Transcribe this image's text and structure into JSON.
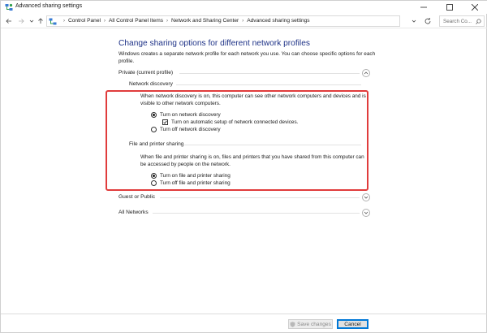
{
  "window": {
    "title": "Advanced sharing settings"
  },
  "breadcrumb": {
    "items": [
      "Control Panel",
      "All Control Panel Items",
      "Network and Sharing Center",
      "Advanced sharing settings"
    ],
    "separator": "›"
  },
  "search": {
    "placeholder": "Search Co..."
  },
  "page": {
    "heading": "Change sharing options for different network profiles",
    "intro": "Windows creates a separate network profile for each network you use. You can choose specific options for each profile."
  },
  "profiles": {
    "private": {
      "label": "Private (current profile)",
      "expanded": true,
      "network_discovery": {
        "label": "Network discovery",
        "description": "When network discovery is on, this computer can see other network computers and devices and is visible to other network computers.",
        "turn_on": "Turn on network discovery",
        "auto_setup": "Turn on automatic setup of network connected devices.",
        "turn_off": "Turn off network discovery",
        "selected": "on",
        "auto_setup_checked": true
      },
      "file_printer_sharing": {
        "label": "File and printer sharing",
        "description": "When file and printer sharing is on, files and printers that you have shared from this computer can be accessed by people on the network.",
        "turn_on": "Turn on file and printer sharing",
        "turn_off": "Turn off file and printer sharing",
        "selected": "on"
      }
    },
    "guest": {
      "label": "Guest or Public",
      "expanded": false
    },
    "all": {
      "label": "All Networks",
      "expanded": false
    }
  },
  "footer": {
    "save_label": "Save changes",
    "cancel_label": "Cancel"
  },
  "colors": {
    "heading": "#1e3287",
    "highlight": "#e03c3c",
    "focus": "#0078d7"
  }
}
